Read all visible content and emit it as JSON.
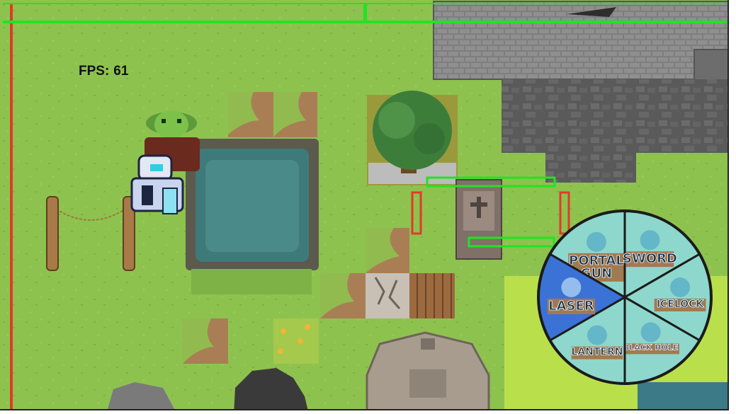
{
  "hud": {
    "fps_label": "FPS:",
    "fps_value": "61"
  },
  "weapon_wheel": {
    "items": [
      {
        "id": "portal-gun",
        "label_line1": "PORTAL",
        "label_line2": "GUN",
        "icon": "portal-gun-icon",
        "selected": false
      },
      {
        "id": "sword",
        "label": "SWORD",
        "icon": "sword-icon",
        "selected": false
      },
      {
        "id": "icelock",
        "label": "ICELOCK",
        "icon": "padlock-ice-icon",
        "selected": false
      },
      {
        "id": "black-hole",
        "label": "BLACK HOLE",
        "icon": "black-hole-icon",
        "selected": false
      },
      {
        "id": "lantern",
        "label": "LANTERN",
        "icon": "lantern-icon",
        "selected": false
      },
      {
        "id": "laser",
        "label": "LASER",
        "icon": "laser-hand-icon",
        "selected": true
      }
    ],
    "colors": {
      "segment": "#8ed7cc",
      "selected": "#3a72d6",
      "outline": "#1b1b1b",
      "label_bg": "#a07a50",
      "label_text": "#15324f"
    }
  },
  "colors": {
    "grass": "#8ec24f",
    "grass_dark": "#7fb246",
    "bright_grass": "#b9e04b",
    "dirt": "#a97e55",
    "water": "#3f7a7a",
    "stone": "#7b7b7b",
    "stone_dark": "#5e5e5e",
    "boundary_red": "#e23a2a",
    "trigger_green": "#22e322"
  }
}
